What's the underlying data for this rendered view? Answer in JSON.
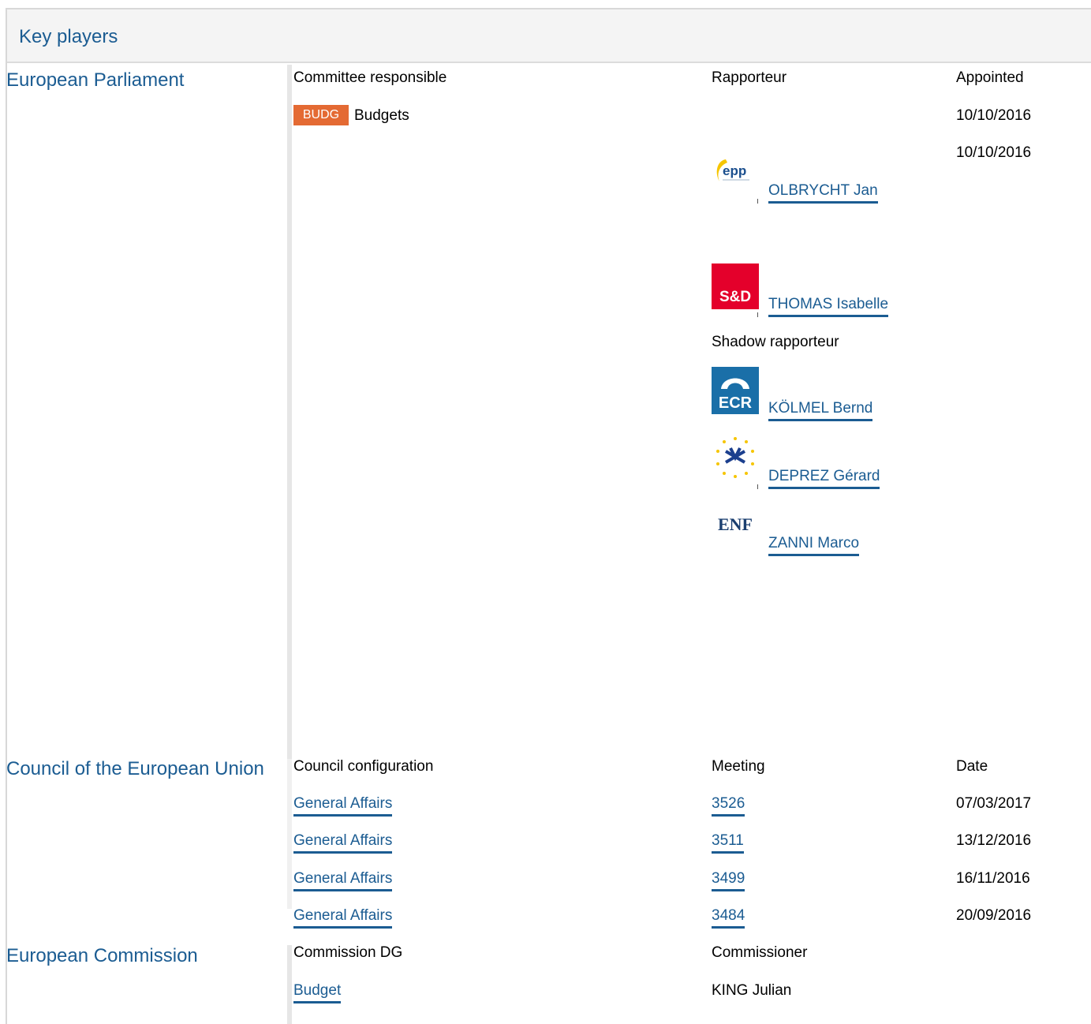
{
  "header": {
    "title": "Key players"
  },
  "ep": {
    "title": "European Parliament",
    "col_committee": "Committee responsible",
    "col_rapporteur": "Rapporteur",
    "col_appointed": "Appointed",
    "badge": "BUDG",
    "committee_name": "Budgets",
    "date1": "10/10/2016",
    "date2": "10/10/2016",
    "rapporteurs": [
      {
        "group_icon": "epp-logo-icon",
        "name": "OLBRYCHT Jan"
      },
      {
        "group_icon": "s-and-d-logo-icon",
        "logo_text": "S&D",
        "name": "THOMAS Isabelle"
      }
    ],
    "shadow_label": "Shadow rapporteur",
    "shadows": [
      {
        "group_icon": "ecr-logo-icon",
        "logo_text": "ECR",
        "name": "KÖLMEL Bernd"
      },
      {
        "group_icon": "efdd-logo-icon",
        "name": "DEPREZ Gérard"
      },
      {
        "group_icon": "enf-logo-icon",
        "logo_text": "ENF",
        "name": "ZANNI Marco"
      }
    ]
  },
  "council": {
    "title": "Council of the European Union",
    "col_config": "Council configuration",
    "col_meeting": "Meeting",
    "col_date": "Date",
    "rows": [
      {
        "config": "General Affairs",
        "meeting": "3526",
        "date": "07/03/2017"
      },
      {
        "config": "General Affairs",
        "meeting": "3511",
        "date": "13/12/2016"
      },
      {
        "config": "General Affairs",
        "meeting": "3499",
        "date": "16/11/2016"
      },
      {
        "config": "General Affairs",
        "meeting": "3484",
        "date": "20/09/2016"
      }
    ]
  },
  "commission": {
    "title": "European Commission",
    "col_dg": "Commission DG",
    "col_commissioner": "Commissioner",
    "dg": "Budget",
    "commissioner": "KING Julian"
  },
  "colors": {
    "link": "#1b5c92",
    "badge": "#e46a33",
    "sd_red": "#e4002b",
    "ecr_blue": "#1a6fa8"
  }
}
